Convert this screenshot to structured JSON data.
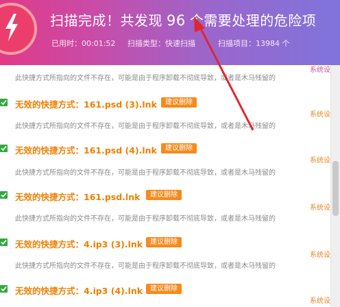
{
  "header": {
    "title_prefix": "扫描完成！共发现",
    "count": "96",
    "title_suffix": "个需要处理的危险项",
    "stats": [
      {
        "label": "已用时：",
        "value": "00:01:52"
      },
      {
        "label": "扫描类型：",
        "value": "快速扫描"
      },
      {
        "label": "扫描项目：",
        "value": "13984 个"
      }
    ],
    "logo_icon": "lightning-bolt-icon"
  },
  "results": {
    "description": "此快捷方式所指向的文件不存在，可能是由于程序卸载不彻底导致，或者是木马残留的",
    "button_label": "建议删除",
    "side_tag": "系统设",
    "side_tag_top": "系统设",
    "items": [
      {
        "title": "无效的快捷方式：161.psd (3).lnk"
      },
      {
        "title": "无效的快捷方式：161.psd (4).lnk"
      },
      {
        "title": "无效的快捷方式：161.psd.lnk"
      },
      {
        "title": "无效的快捷方式：4.ip3 (3).lnk"
      },
      {
        "title": "无效的快捷方式：4.ip3 (4).lnk"
      }
    ]
  },
  "colors": {
    "accent_orange": "#f07f00",
    "button_orange": "#f78a1c",
    "check_green": "#2eaa3c",
    "arrow_red": "#e0262e"
  }
}
